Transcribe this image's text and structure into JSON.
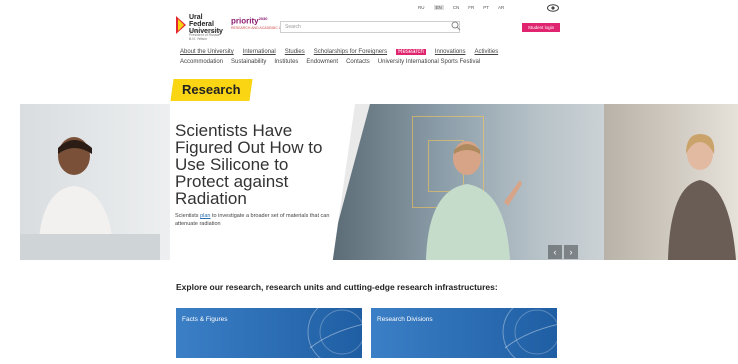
{
  "header": {
    "logo_line1": "Ural Federal",
    "logo_line2": "University",
    "logo_sub": "named after the first President of Russia B.N. Yeltsin",
    "priority_label": "priority",
    "priority_year": "2030",
    "priority_sub": "RESEARCH AND ACADEMIC LEADERSHIP",
    "search_placeholder": "Search",
    "login_label": "Student login",
    "languages": [
      "RU",
      "EN",
      "CN",
      "FR",
      "PT",
      "AR"
    ],
    "active_language": "EN"
  },
  "nav": {
    "row1": [
      "About the University",
      "International",
      "Studies",
      "Scholarships for Foreigners",
      "Research",
      "Innovations",
      "Activities"
    ],
    "active": "Research",
    "row2": [
      "Accommodation",
      "Sustainability",
      "Institutes",
      "Endowment",
      "Contacts",
      "University International Sports Festival"
    ]
  },
  "page": {
    "badge": "Research"
  },
  "hero": {
    "title": "Scientists Have Figured Out How to Use Silicone to Protect against Radiation",
    "desc_before": "Scientists ",
    "desc_link": "plan",
    "desc_after": " to investigate a broader set of materials that can attenuate radiation",
    "prev_icon": "chevron-left-icon",
    "next_icon": "chevron-right-icon"
  },
  "explore": {
    "heading": "Explore our research, research units and cutting-edge research infrastructures:",
    "cards": [
      {
        "label": "Facts & Figures"
      },
      {
        "label": "Research Divisions"
      }
    ]
  },
  "colors": {
    "accent": "#e0246f",
    "badge": "#f9d514",
    "card": "#2f6fb5"
  }
}
